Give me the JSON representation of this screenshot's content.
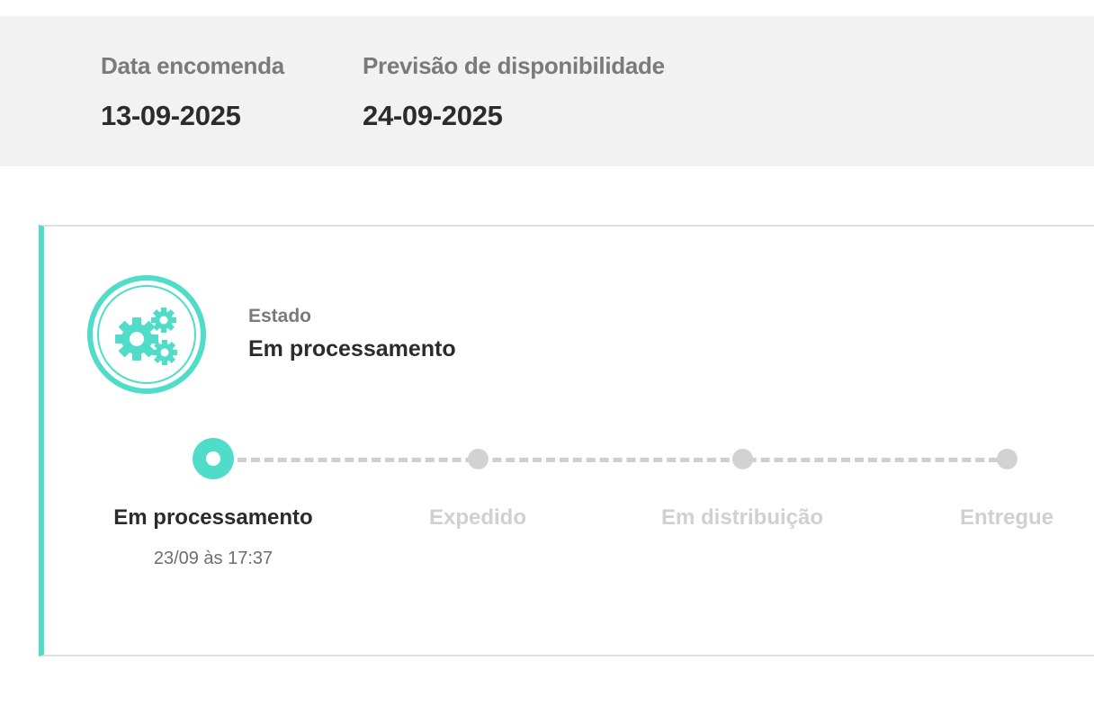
{
  "summary": {
    "order_date_label": "Data encomenda",
    "order_date_value": "13-09-2025",
    "availability_label": "Previsão de disponibilidade",
    "availability_value": "24-09-2025"
  },
  "status": {
    "label": "Estado",
    "value": "Em processamento",
    "icon": "gears-icon"
  },
  "timeline": {
    "steps": [
      {
        "label": "Em processamento",
        "time": "23/09 às 17:37",
        "active": true
      },
      {
        "label": "Expedido",
        "time": "",
        "active": false
      },
      {
        "label": "Em distribuição",
        "time": "",
        "active": false
      },
      {
        "label": "Entregue",
        "time": "",
        "active": false
      }
    ]
  },
  "colors": {
    "accent": "#4fdcc8",
    "inactive": "#d2d2d2",
    "summary_bg": "#f2f2f2"
  }
}
